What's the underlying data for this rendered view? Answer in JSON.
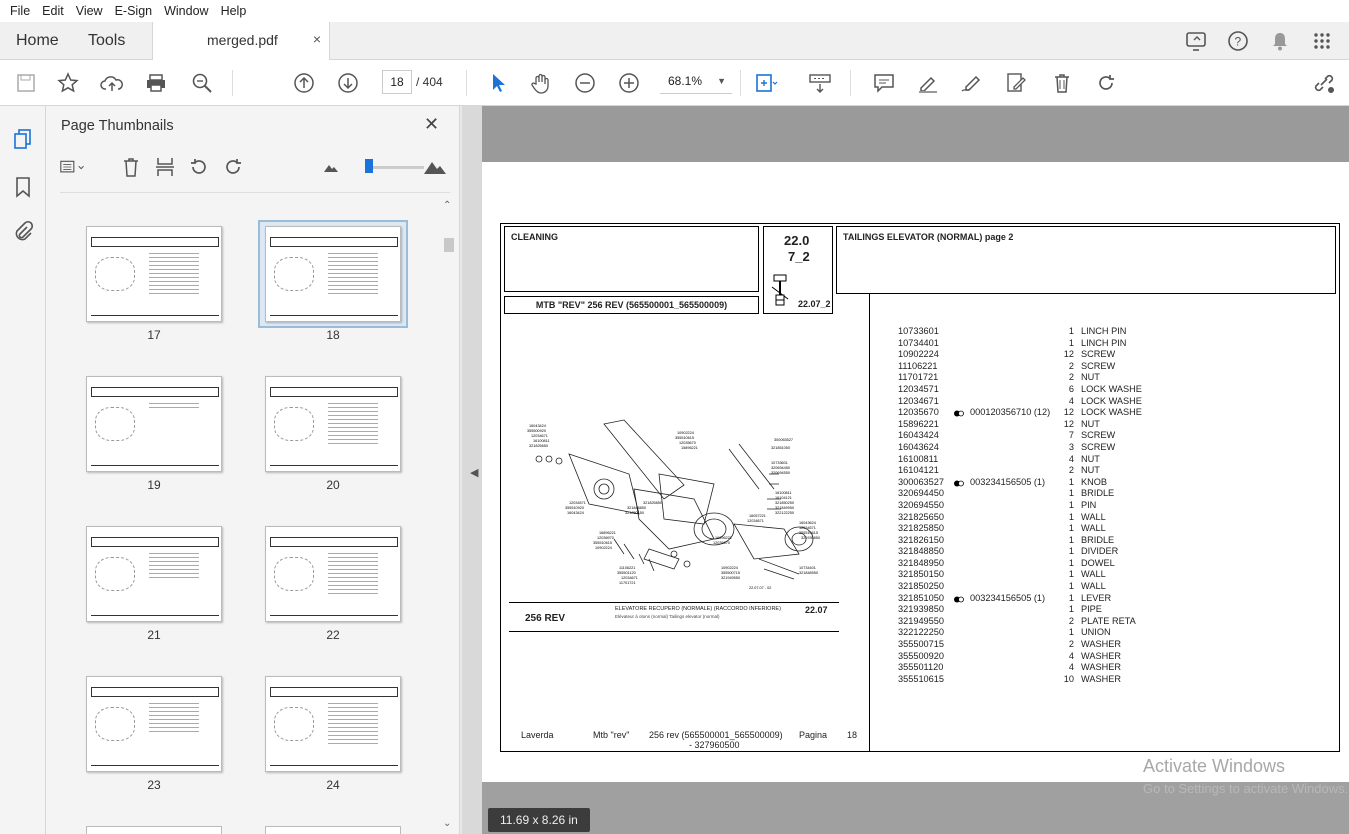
{
  "menu": [
    "File",
    "Edit",
    "View",
    "E-Sign",
    "Window",
    "Help"
  ],
  "tabs": {
    "home": "Home",
    "tools": "Tools",
    "document": "merged.pdf",
    "close": "×"
  },
  "toolbar": {
    "page_current": "18",
    "page_sep_total": "/ 404",
    "zoom": "68.1%"
  },
  "panel": {
    "title": "Page Thumbnails",
    "close": "✕"
  },
  "thumbnails": [
    {
      "label": "17"
    },
    {
      "label": "18",
      "selected": true
    },
    {
      "label": "19"
    },
    {
      "label": "20"
    },
    {
      "label": "21"
    },
    {
      "label": "22"
    },
    {
      "label": "23"
    },
    {
      "label": "24"
    }
  ],
  "page": {
    "section": "CLEANING",
    "num1": "22.0",
    "num2": "7_2",
    "num3": "22.07_2",
    "title": "TAILINGS ELEVATOR (NORMAL)  page 2",
    "model": "MTB \"REV\" 256 REV (565500001_565500009)",
    "caption_rev": "256 REV",
    "caption_title": "ELEVATORE RECUPERO (NORMALE) (RACCORDO INFERIORE)",
    "caption_sub": "Elévateur à otons (normal)   Tailings elevator (normal)",
    "caption_code": "22.07",
    "footer_brand": "Laverda",
    "footer_model": "Mtb \"rev\"",
    "footer_serial": "256 rev (565500001_565500009)",
    "footer_code": "- 327960500",
    "footer_page_label": "Pagina",
    "footer_page": "18",
    "parts": [
      {
        "pn": "10733601",
        "ref": "",
        "qty": "1",
        "desc": "LINCH PIN"
      },
      {
        "pn": "10734401",
        "ref": "",
        "qty": "1",
        "desc": "LINCH PIN"
      },
      {
        "pn": "10902224",
        "ref": "",
        "qty": "12",
        "desc": "SCREW"
      },
      {
        "pn": "11106221",
        "ref": "",
        "qty": "2",
        "desc": "SCREW"
      },
      {
        "pn": "11701721",
        "ref": "",
        "qty": "2",
        "desc": "NUT"
      },
      {
        "pn": "12034571",
        "ref": "",
        "qty": "6",
        "desc": "LOCK WASHE"
      },
      {
        "pn": "12034671",
        "ref": "",
        "qty": "4",
        "desc": "LOCK WASHE"
      },
      {
        "pn": "12035670",
        "ref": "000120356710  (12)",
        "qty": "12",
        "desc": "LOCK WASHE"
      },
      {
        "pn": "15896221",
        "ref": "",
        "qty": "12",
        "desc": "NUT"
      },
      {
        "pn": "16043424",
        "ref": "",
        "qty": "7",
        "desc": "SCREW"
      },
      {
        "pn": "16043624",
        "ref": "",
        "qty": "3",
        "desc": "SCREW"
      },
      {
        "pn": "16100811",
        "ref": "",
        "qty": "4",
        "desc": "NUT"
      },
      {
        "pn": "16104121",
        "ref": "",
        "qty": "2",
        "desc": "NUT"
      },
      {
        "pn": "300063527",
        "ref": "003234156505  (1)",
        "qty": "1",
        "desc": "KNOB"
      },
      {
        "pn": "320694450",
        "ref": "",
        "qty": "1",
        "desc": "BRIDLE"
      },
      {
        "pn": "320694550",
        "ref": "",
        "qty": "1",
        "desc": "PIN"
      },
      {
        "pn": "321825650",
        "ref": "",
        "qty": "1",
        "desc": "WALL"
      },
      {
        "pn": "321825850",
        "ref": "",
        "qty": "1",
        "desc": "WALL"
      },
      {
        "pn": "321826150",
        "ref": "",
        "qty": "1",
        "desc": "BRIDLE"
      },
      {
        "pn": "321848850",
        "ref": "",
        "qty": "1",
        "desc": "DIVIDER"
      },
      {
        "pn": "321848950",
        "ref": "",
        "qty": "1",
        "desc": "DOWEL"
      },
      {
        "pn": "321850150",
        "ref": "",
        "qty": "1",
        "desc": "WALL"
      },
      {
        "pn": "321850250",
        "ref": "",
        "qty": "1",
        "desc": "WALL"
      },
      {
        "pn": "321851050",
        "ref": "003234156505  (1)",
        "qty": "1",
        "desc": "LEVER"
      },
      {
        "pn": "321939850",
        "ref": "",
        "qty": "1",
        "desc": "PIPE"
      },
      {
        "pn": "321949550",
        "ref": "",
        "qty": "2",
        "desc": "PLATE RETA"
      },
      {
        "pn": "322122250",
        "ref": "",
        "qty": "1",
        "desc": "UNION"
      },
      {
        "pn": "355500715",
        "ref": "",
        "qty": "2",
        "desc": "WASHER"
      },
      {
        "pn": "355500920",
        "ref": "",
        "qty": "4",
        "desc": "WASHER"
      },
      {
        "pn": "355501120",
        "ref": "",
        "qty": "4",
        "desc": "WASHER"
      },
      {
        "pn": "355510615",
        "ref": "",
        "qty": "10",
        "desc": "WASHER"
      }
    ]
  },
  "status": {
    "page_size": "11.69 x 8.26 in"
  },
  "watermark": {
    "line1": "Activate Windows",
    "line2": "Go to Settings to activate Windows."
  }
}
